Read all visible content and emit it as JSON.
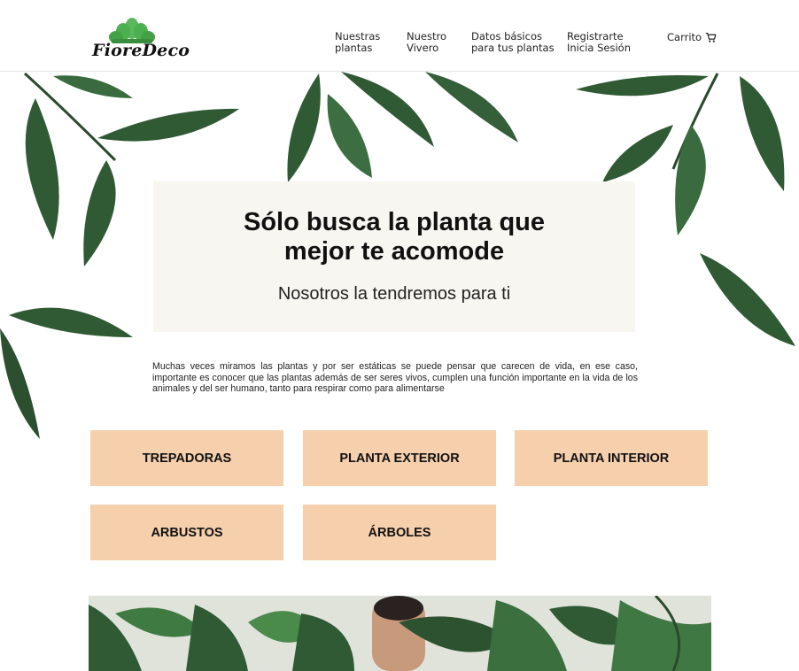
{
  "header": {
    "logo_text": "FioreDeco",
    "nav": [
      {
        "line1": "Nuestras",
        "line2": "plantas"
      },
      {
        "line1": "Nuestro",
        "line2": "Vivero"
      },
      {
        "line1": "Datos básicos",
        "line2": "para tus plantas"
      },
      {
        "line1": "Registrarte",
        "line2": "Inicia Sesión"
      }
    ],
    "cart_label": "Carrito"
  },
  "hero": {
    "title_line1": "Sólo busca la planta que",
    "title_line2": "mejor te acomode",
    "subtitle": "Nosotros la tendremos para ti"
  },
  "intro_text": "Muchas veces miramos las plantas y por ser estáticas se puede pensar que carecen de vida, en ese caso, importante es conocer que las plantas además de ser seres vivos, cumplen una función importante en la vida de los animales y del ser humano, tanto para respirar como para alimentarse",
  "categories": [
    "TREPADORAS",
    "PLANTA EXTERIOR",
    "PLANTA INTERIOR",
    "ARBUSTOS",
    "ÁRBOLES"
  ],
  "colors": {
    "category_bg": "#f6cfad",
    "card_bg": "#f8f6f0",
    "leaf": "#2f5a34",
    "logo_green": "#4caf50"
  },
  "icons": {
    "cart": "shopping-cart-icon",
    "logo": "plant-logo-icon"
  }
}
